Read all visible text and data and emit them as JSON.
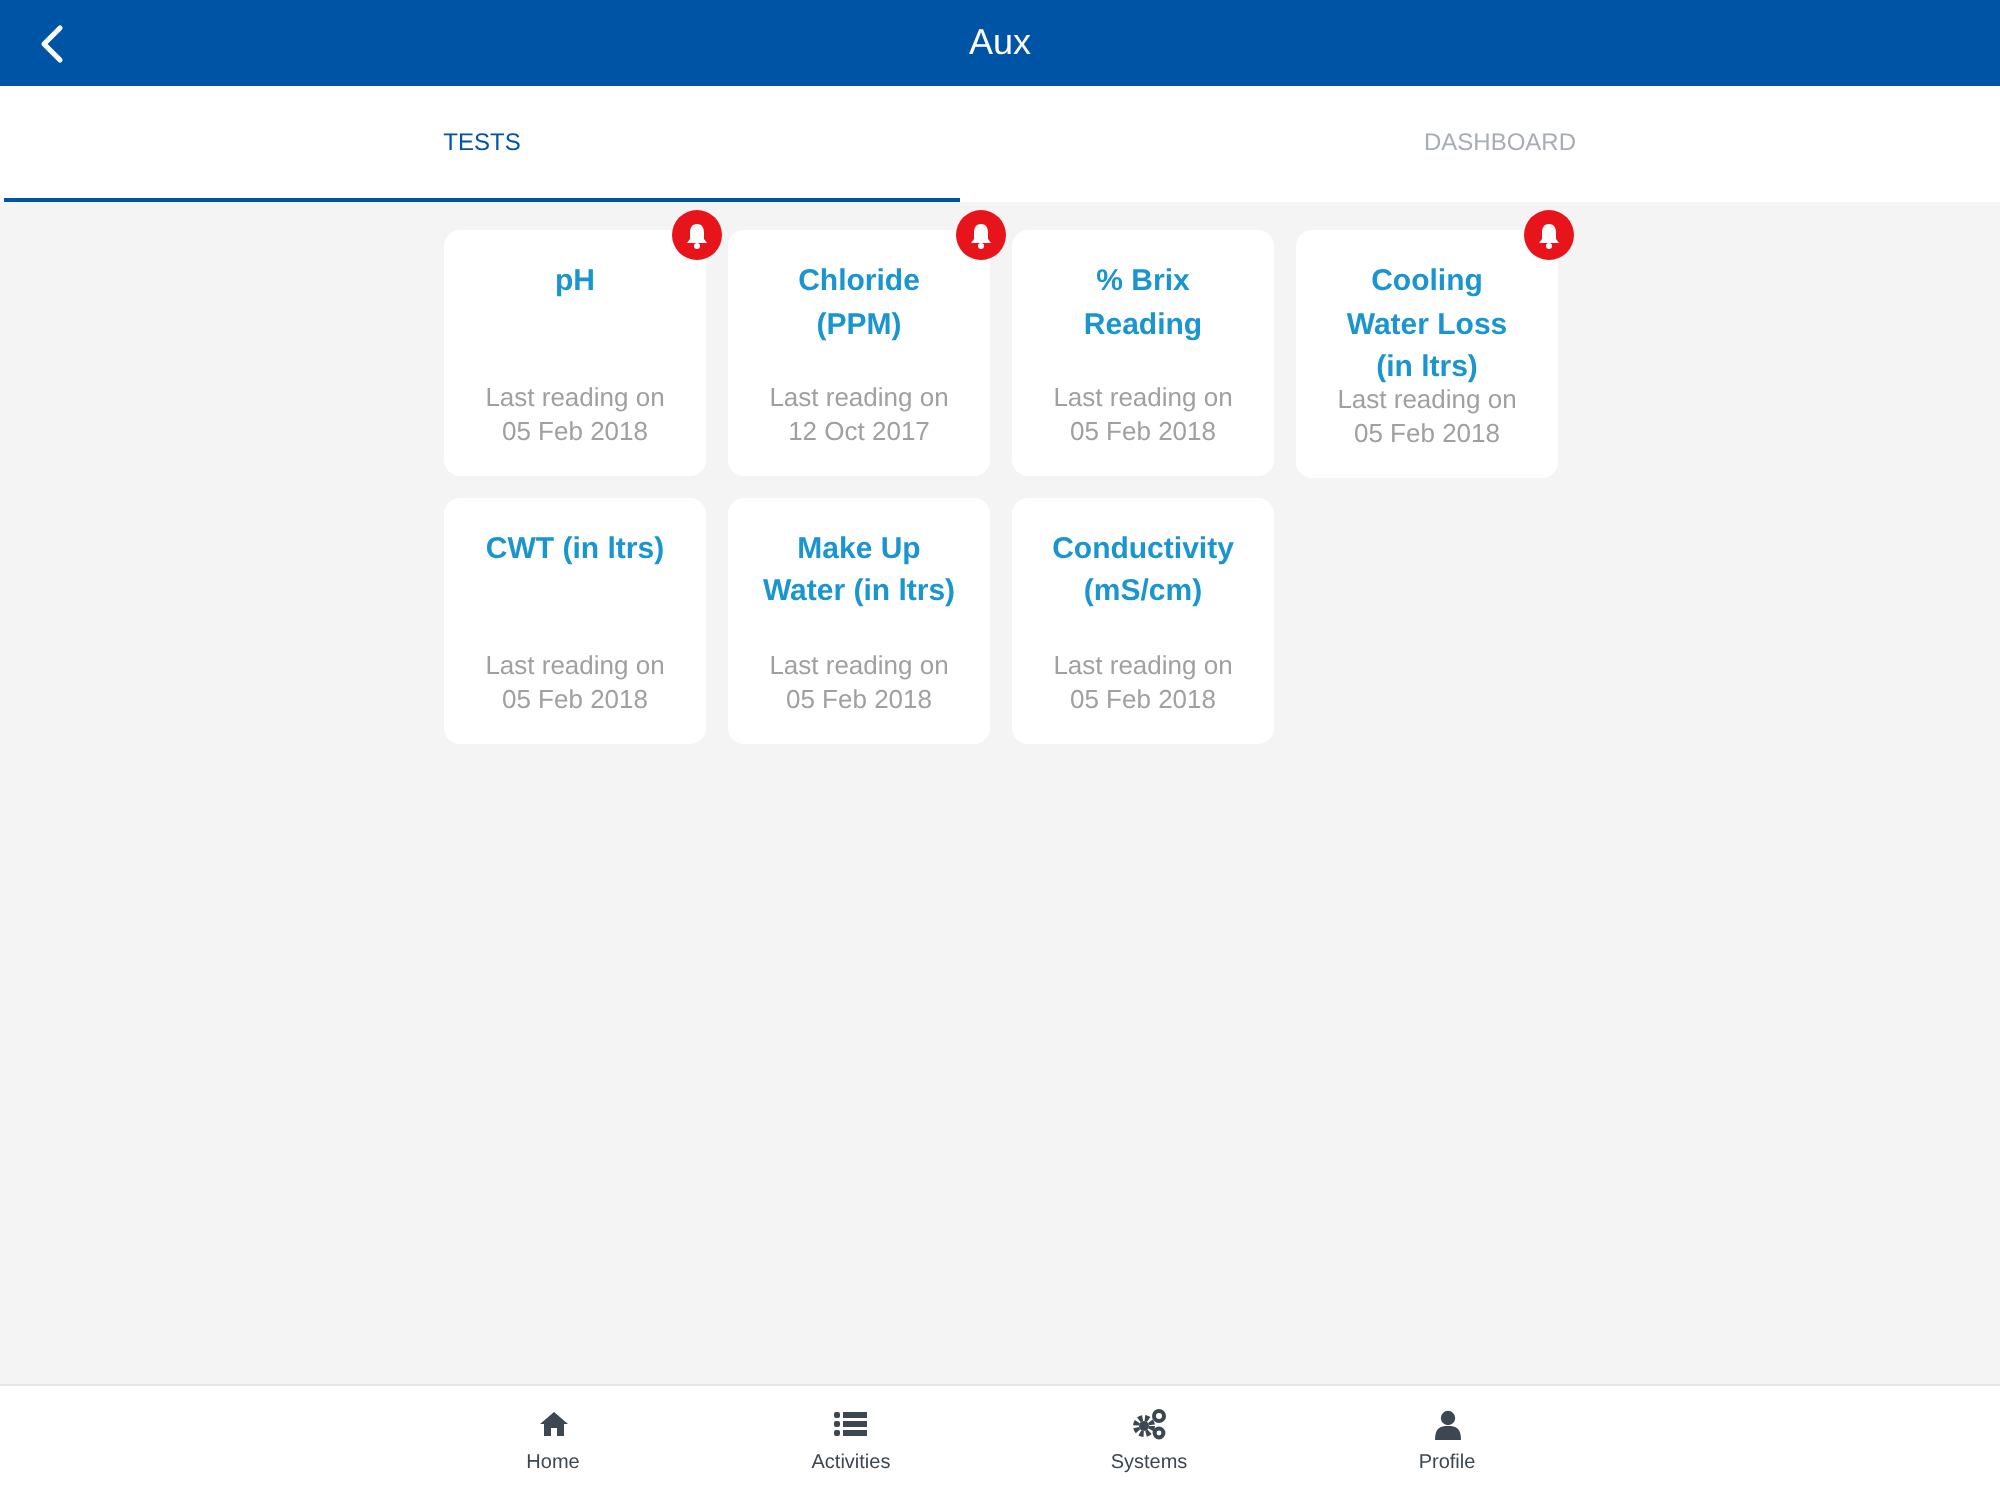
{
  "header": {
    "title": "Aux"
  },
  "tabs": [
    {
      "label": "TESTS",
      "selected": true
    },
    {
      "label": "DASHBOARD",
      "selected": false
    }
  ],
  "tests": [
    {
      "name": "pH",
      "caption": "Last reading on",
      "date": "05 Feb 2018",
      "alert": true
    },
    {
      "name": "Chloride (PPM)",
      "caption": "Last reading on",
      "date": "12 Oct 2017",
      "alert": true
    },
    {
      "name": "% Brix Reading",
      "caption": "Last reading on",
      "date": "05 Feb 2018",
      "alert": false
    },
    {
      "name": "Cooling Water Loss (in ltrs)",
      "caption": "Last reading on",
      "date": "05 Feb 2018",
      "alert": true
    },
    {
      "name": "CWT (in ltrs)",
      "caption": "Last reading on",
      "date": "05 Feb 2018",
      "alert": false
    },
    {
      "name": "Make Up Water (in ltrs)",
      "caption": "Last reading on",
      "date": "05 Feb 2018",
      "alert": false
    },
    {
      "name": "Conductivity (mS/cm)",
      "caption": "Last reading on",
      "date": "05 Feb 2018",
      "alert": false
    }
  ],
  "bottom_nav": [
    {
      "kind": "home",
      "label": "Home"
    },
    {
      "kind": "activities",
      "label": "Activities"
    },
    {
      "kind": "systems",
      "label": "Systems"
    },
    {
      "kind": "profile",
      "label": "Profile"
    }
  ]
}
